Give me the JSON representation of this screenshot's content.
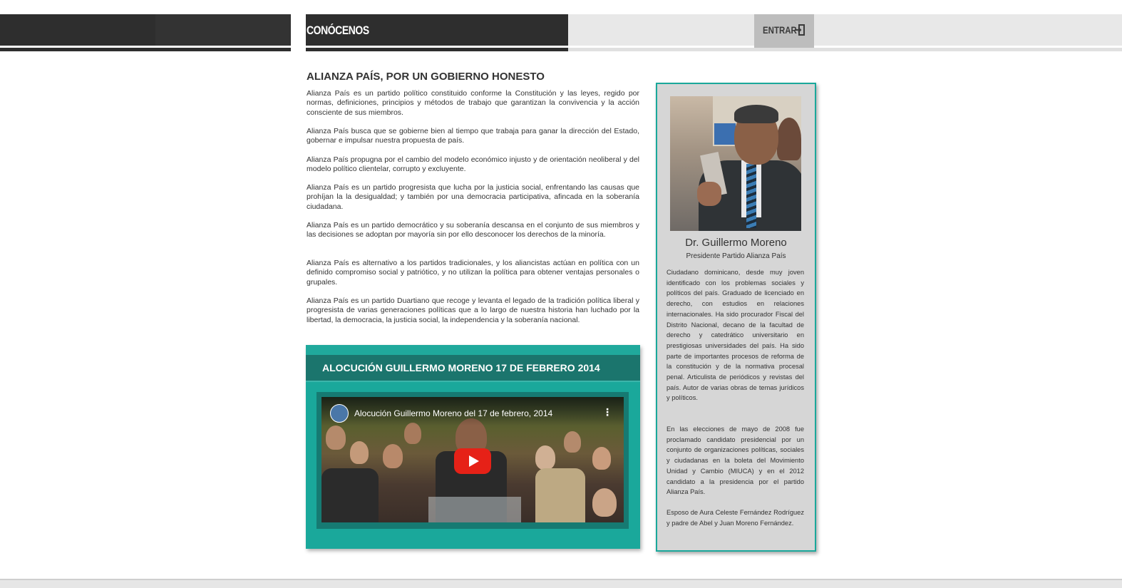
{
  "header": {
    "section_title": "CONÓCENOS",
    "login_label": "ENTRAR",
    "login_icon": "enter-icon"
  },
  "main": {
    "heading": "ALIANZA PAÍS, POR UN GOBIERNO HONESTO",
    "paragraphs": [
      "Alianza País es un partido político constituido conforme la Constitución y las leyes, regido por normas, definiciones, principios y métodos de trabajo que garantizan la convivencia y la acción consciente de sus miembros.",
      "Alianza País busca que se gobierne bien al tiempo que trabaja para ganar la dirección del Estado, gobernar e impulsar nuestra propuesta de país.",
      "Alianza País propugna por el cambio del modelo económico injusto y de orientación neoliberal y del modelo político clientelar, corrupto y excluyente.",
      "Alianza País es un partido progresista que lucha por la justicia social, enfrentando las causas que prohíjan la la desigualdad; y también por una democracia participativa, afincada en la soberanía ciudadana.",
      "Alianza País es un partido democrático y su soberanía descansa en el conjunto de sus miembros y las decisiones se adoptan por mayoría sin por ello desconocer los derechos de la minoría.",
      "Alianza País es alternativo a los partidos tradicionales, y los aliancistas actúan en política con un definido compromiso social y patriótico, y no utilizan la política para obtener ventajas personales o grupales.",
      "Alianza País es un partido Duartiano que recoge y levanta el legado de la tradición política liberal y progresista de varias generaciones políticas que a lo largo de nuestra historia han luchado por la libertad, la democracia, la justicia social, la independencia y la soberanía nacional."
    ]
  },
  "video_panel": {
    "title": "ALOCUCIÓN GUILLERMO MORENO 17 DE FEBRERO 2014",
    "video_title": "Alocución Guillermo Moreno del 17 de febrero, 2014",
    "menu_glyph": "⋮"
  },
  "sidebar": {
    "name": "Dr. Guillermo Moreno",
    "role": "Presidente Partido Alianza País",
    "bio": [
      "Ciudadano dominicano, desde muy joven identificado con los problemas sociales y políticos del país. Graduado de licenciado en derecho, con estudios en relaciones internacionales. Ha sido procurador Fiscal del Distrito Nacional, decano de la facultad de derecho y catedrático universitario en prestigiosas universidades del país. Ha sido parte de importantes procesos de reforma de la constitución y de la normativa procesal penal. Articulista de periódicos y revistas del país. Autor de varias obras de temas jurídicos y políticos.",
      "En las elecciones de mayo de 2008 fue proclamado candidato presidencial por un conjunto de organizaciones políticas, sociales y ciudadanas en la boleta del Movimiento Unidad y Cambio (MIUCA) y en el 2012 candidato a la presidencia por el partido Alianza País.",
      "Esposo de Aura Celeste Fernández Rodríguez y padre de Abel y Juan Moreno Fernández."
    ]
  },
  "colors": {
    "accent_teal": "#1aa89b",
    "dark_teal": "#1b756d",
    "header_dark": "#2e2e2e",
    "youtube_red": "#e62117"
  }
}
